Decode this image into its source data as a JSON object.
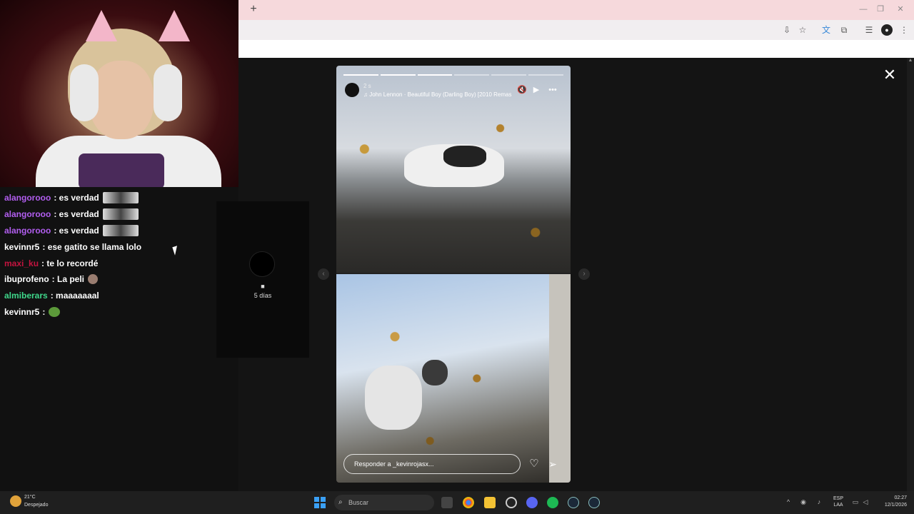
{
  "browser": {
    "new_tab": "+",
    "window_controls": {
      "minimize": "—",
      "restore": "❐",
      "close": "✕"
    },
    "toolbar_icons": [
      "install-icon",
      "bookmark-star-icon",
      "translate-icon",
      "extensions-icon",
      "reading-list-icon",
      "profile-icon",
      "menu-icon"
    ]
  },
  "chat": {
    "messages": [
      {
        "user": "alangorooo",
        "color": "#b25ef0",
        "text": ": es verdad",
        "emote": "wide"
      },
      {
        "user": "alangorooo",
        "color": "#b25ef0",
        "text": ": es verdad",
        "emote": "wide"
      },
      {
        "user": "alangorooo",
        "color": "#b25ef0",
        "text": ": es verdad",
        "emote": "wide"
      },
      {
        "user": "kevinnr5",
        "color": "#ffffff",
        "text": ": ese gatito se llama lolo",
        "emote": ""
      },
      {
        "user": "maxi_ku",
        "color": "#c4143f",
        "text": ": te lo recordé",
        "emote": ""
      },
      {
        "user": "ibuprofeno",
        "color": "#ffffff",
        "text": ": La peli",
        "emote": "small"
      },
      {
        "user": "almiberars",
        "color": "#3fd88b",
        "text": ": maaaaaaal",
        "emote": ""
      },
      {
        "user": "kevinnr5",
        "color": "#ffffff",
        "text": ":",
        "emote": "frog"
      }
    ]
  },
  "prev_story": {
    "user": "■",
    "time": "5 días"
  },
  "story": {
    "user": "2 s",
    "music": "John Lennon · Beautiful Boy (Darling Boy) [2010 Remas",
    "reply_placeholder": "Responder a _kevinrojasx...",
    "progress_segments": 6,
    "progress_done": 3
  },
  "close_label": "✕",
  "taskbar": {
    "weather_temp": "21°C",
    "weather_desc": "Despejado",
    "search_placeholder": "Buscar",
    "lang_top": "ESP",
    "lang_bottom": "LAA",
    "time": "02:27",
    "date": "12/1/2026"
  }
}
